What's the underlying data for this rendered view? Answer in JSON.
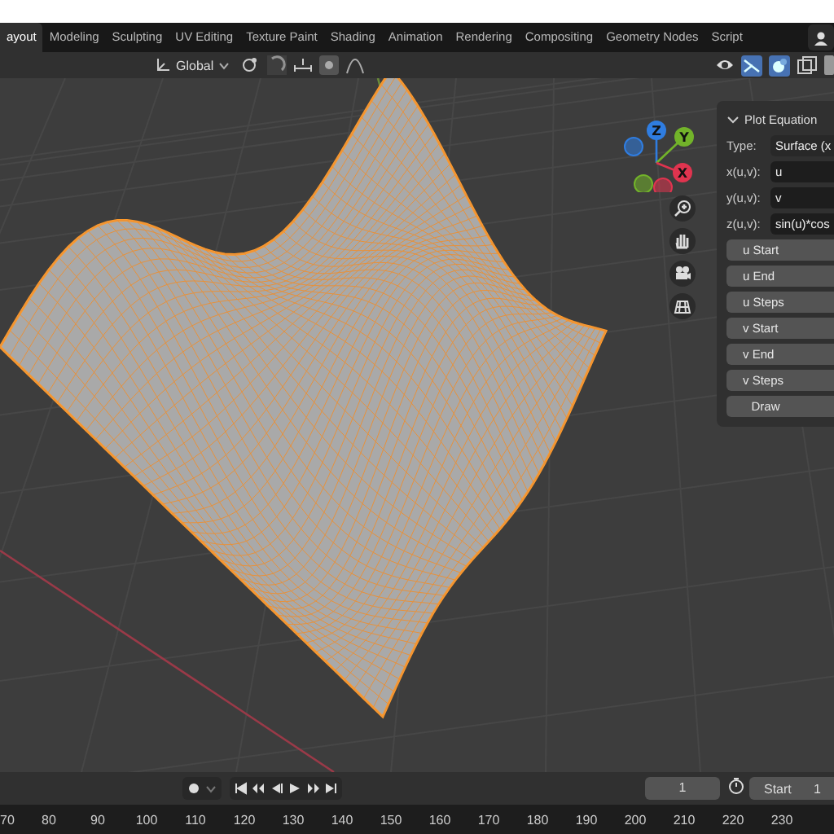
{
  "workspace_tabs": [
    {
      "label": "ayout",
      "selected": true
    },
    {
      "label": "Modeling",
      "selected": false
    },
    {
      "label": "Sculpting",
      "selected": false
    },
    {
      "label": "UV Editing",
      "selected": false
    },
    {
      "label": "Texture Paint",
      "selected": false
    },
    {
      "label": "Shading",
      "selected": false
    },
    {
      "label": "Animation",
      "selected": false
    },
    {
      "label": "Rendering",
      "selected": false
    },
    {
      "label": "Compositing",
      "selected": false
    },
    {
      "label": "Geometry Nodes",
      "selected": false
    },
    {
      "label": "Script",
      "selected": false
    }
  ],
  "header": {
    "orientation": "Global"
  },
  "gizmo": {
    "axes": [
      {
        "label": "Z",
        "color": "#2f7de1"
      },
      {
        "label": "Y",
        "color": "#72b32a"
      },
      {
        "label": "X",
        "color": "#e0344f"
      }
    ]
  },
  "panel": {
    "title": "Plot Equation",
    "expanded": true,
    "fields": [
      {
        "kind": "dropdown",
        "label": "Type:",
        "value": "Surface (x"
      },
      {
        "kind": "text",
        "label": "x(u,v):",
        "value": "u"
      },
      {
        "kind": "text",
        "label": "y(u,v):",
        "value": "v"
      },
      {
        "kind": "text",
        "label": "z(u,v):",
        "value": "sin(u)*cos"
      }
    ],
    "buttons": [
      {
        "kind": "property",
        "label": "u Start"
      },
      {
        "kind": "property",
        "label": "u End"
      },
      {
        "kind": "property",
        "label": "u Steps"
      },
      {
        "kind": "property",
        "label": "v Start"
      },
      {
        "kind": "property",
        "label": "v End"
      },
      {
        "kind": "property",
        "label": "v Steps"
      },
      {
        "kind": "action",
        "label": "Draw"
      }
    ]
  },
  "timeline": {
    "current_frame": "1",
    "start_label": "Start",
    "start_value": "1",
    "ruler": [
      "70",
      "80",
      "90",
      "100",
      "110",
      "120",
      "130",
      "140",
      "150",
      "160",
      "170",
      "180",
      "190",
      "200",
      "210",
      "220",
      "230"
    ]
  }
}
